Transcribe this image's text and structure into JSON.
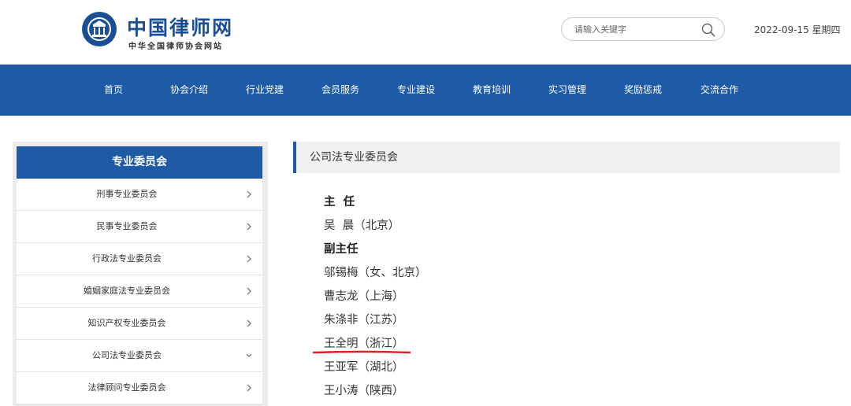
{
  "header": {
    "logo_title": "中国律师网",
    "logo_subtitle": "中华全国律师协会网站",
    "search_placeholder": "请输入关键字",
    "date": "2022-09-15 星期四"
  },
  "nav": {
    "items": [
      "首页",
      "协会介绍",
      "行业党建",
      "会员服务",
      "专业建设",
      "教育培训",
      "实习管理",
      "奖励惩戒",
      "交流合作"
    ]
  },
  "sidebar": {
    "title": "专业委员会",
    "items": [
      {
        "label": "刑事专业委员会",
        "icon": "chevron-right-icon"
      },
      {
        "label": "民事专业委员会",
        "icon": "chevron-right-icon"
      },
      {
        "label": "行政法专业委员会",
        "icon": "chevron-right-icon"
      },
      {
        "label": "婚姻家庭法专业委员会",
        "icon": "chevron-right-icon"
      },
      {
        "label": "知识产权专业委员会",
        "icon": "chevron-right-icon"
      },
      {
        "label": "公司法专业委员会",
        "icon": "chevron-down-icon"
      },
      {
        "label": "法律顾问专业委员会",
        "icon": "chevron-right-icon"
      }
    ]
  },
  "content": {
    "title": "公司法专业委员会",
    "rows": [
      {
        "text": "主  任",
        "role": true
      },
      {
        "text": "吴  晨（北京）",
        "role": false
      },
      {
        "text": "副主任",
        "role": true
      },
      {
        "text": "邬锡梅（女、北京）",
        "role": false
      },
      {
        "text": "曹志龙（上海）",
        "role": false
      },
      {
        "text": "朱涤非（江苏）",
        "role": false
      },
      {
        "text": "王全明（浙江）",
        "role": false
      },
      {
        "text": "王亚军（湖北）",
        "role": false
      },
      {
        "text": "王小涛（陕西）",
        "role": false
      }
    ]
  },
  "colors": {
    "brand_blue": "#1e5aa6",
    "highlight_red": "#e02020"
  }
}
